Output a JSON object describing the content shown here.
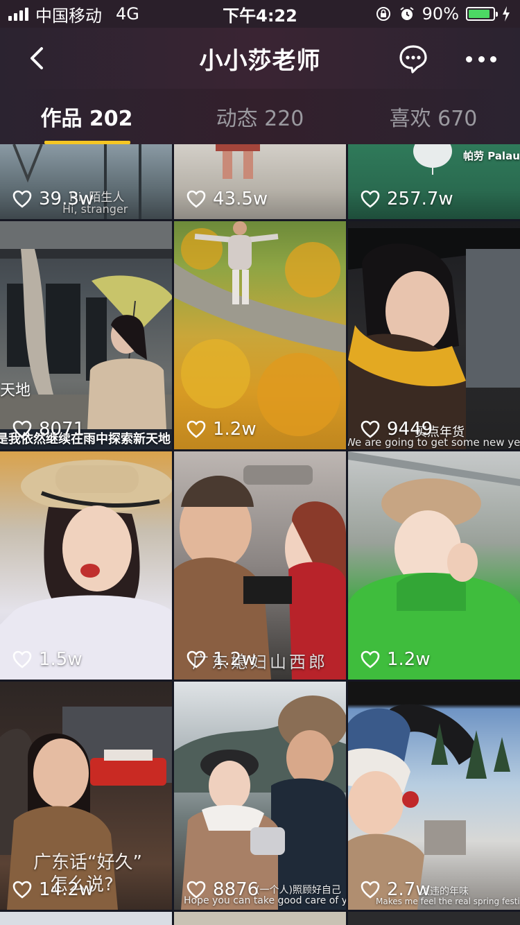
{
  "status_bar": {
    "carrier": "中国移动",
    "network": "4G",
    "time": "下午4:22",
    "battery": "90%"
  },
  "nav": {
    "title": "小小莎老师"
  },
  "tabs": [
    {
      "label": "作品 202",
      "active": true
    },
    {
      "label": "动态 220",
      "active": false
    },
    {
      "label": "喜欢 670",
      "active": false
    }
  ],
  "videos": [
    {
      "likes": "39.3w",
      "caption": "Hi,  陌生人",
      "caption2": "Hi,  stranger"
    },
    {
      "likes": "43.5w"
    },
    {
      "likes": "257.7w",
      "caption": "帕劳 Palau"
    },
    {
      "likes": "8071",
      "caption": "天地",
      "caption2": "是我依然继续在雨中探索新天地"
    },
    {
      "likes": "1.2w"
    },
    {
      "likes": "9449",
      "caption": "买点年货",
      "caption2": "We are going to get some new year gi"
    },
    {
      "likes": "1.5w"
    },
    {
      "likes": "1.2w",
      "caption": "广东媳妇山西郎"
    },
    {
      "likes": "1.2w"
    },
    {
      "likes": "14.2w",
      "caption": "广东话“好久”",
      "caption2": "怎么说?"
    },
    {
      "likes": "8876",
      "caption": "(一个人)照顾好自己",
      "caption2": "Hope you can take good care of yourse"
    },
    {
      "likes": "2.7w",
      "caption": "久违的年味",
      "caption2": "Makes me feel the real spring festival"
    }
  ]
}
